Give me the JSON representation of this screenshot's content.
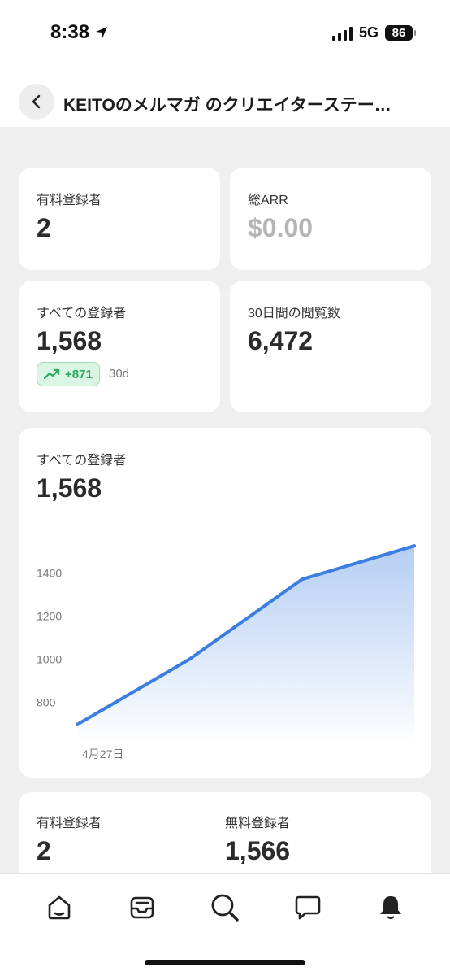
{
  "status_bar": {
    "time": "8:38",
    "network": "5G",
    "battery": "86"
  },
  "header": {
    "title": "KEITOのメルマガ のクリエイターステー…"
  },
  "stats": {
    "paid_subscribers": {
      "label": "有料登録者",
      "value": "2"
    },
    "total_arr": {
      "label": "総ARR",
      "value": "$0.00"
    },
    "all_subscribers": {
      "label": "すべての登録者",
      "value": "1,568",
      "trend": "+871",
      "trend_period": "30d"
    },
    "views_30d": {
      "label": "30日間の閲覧数",
      "value": "6,472"
    }
  },
  "chart": {
    "label": "すべての登録者",
    "value": "1,568"
  },
  "chart_data": {
    "type": "area",
    "title": "すべての登録者",
    "x": [
      "4月27日",
      "",
      "",
      ""
    ],
    "series": [
      {
        "values": [
          697,
          1000,
          1370,
          1525
        ]
      }
    ],
    "y_ticks": [
      "1400",
      "1200",
      "1000",
      "800"
    ],
    "x_tick_labels": [
      "4月27日"
    ],
    "ylim": [
      640,
      1620
    ],
    "grid": false,
    "line_color": "#3b7de0"
  },
  "breakdown": {
    "paid": {
      "label": "有料登録者",
      "value": "2"
    },
    "free": {
      "label": "無料登録者",
      "value": "1,566"
    }
  },
  "tabs": [
    "home-icon",
    "inbox-icon",
    "search-icon",
    "chat-icon",
    "bell-icon"
  ],
  "colors": {
    "accent_blue": "#3b7de0",
    "trend_green": "#2ea860",
    "background": "#efefef"
  }
}
